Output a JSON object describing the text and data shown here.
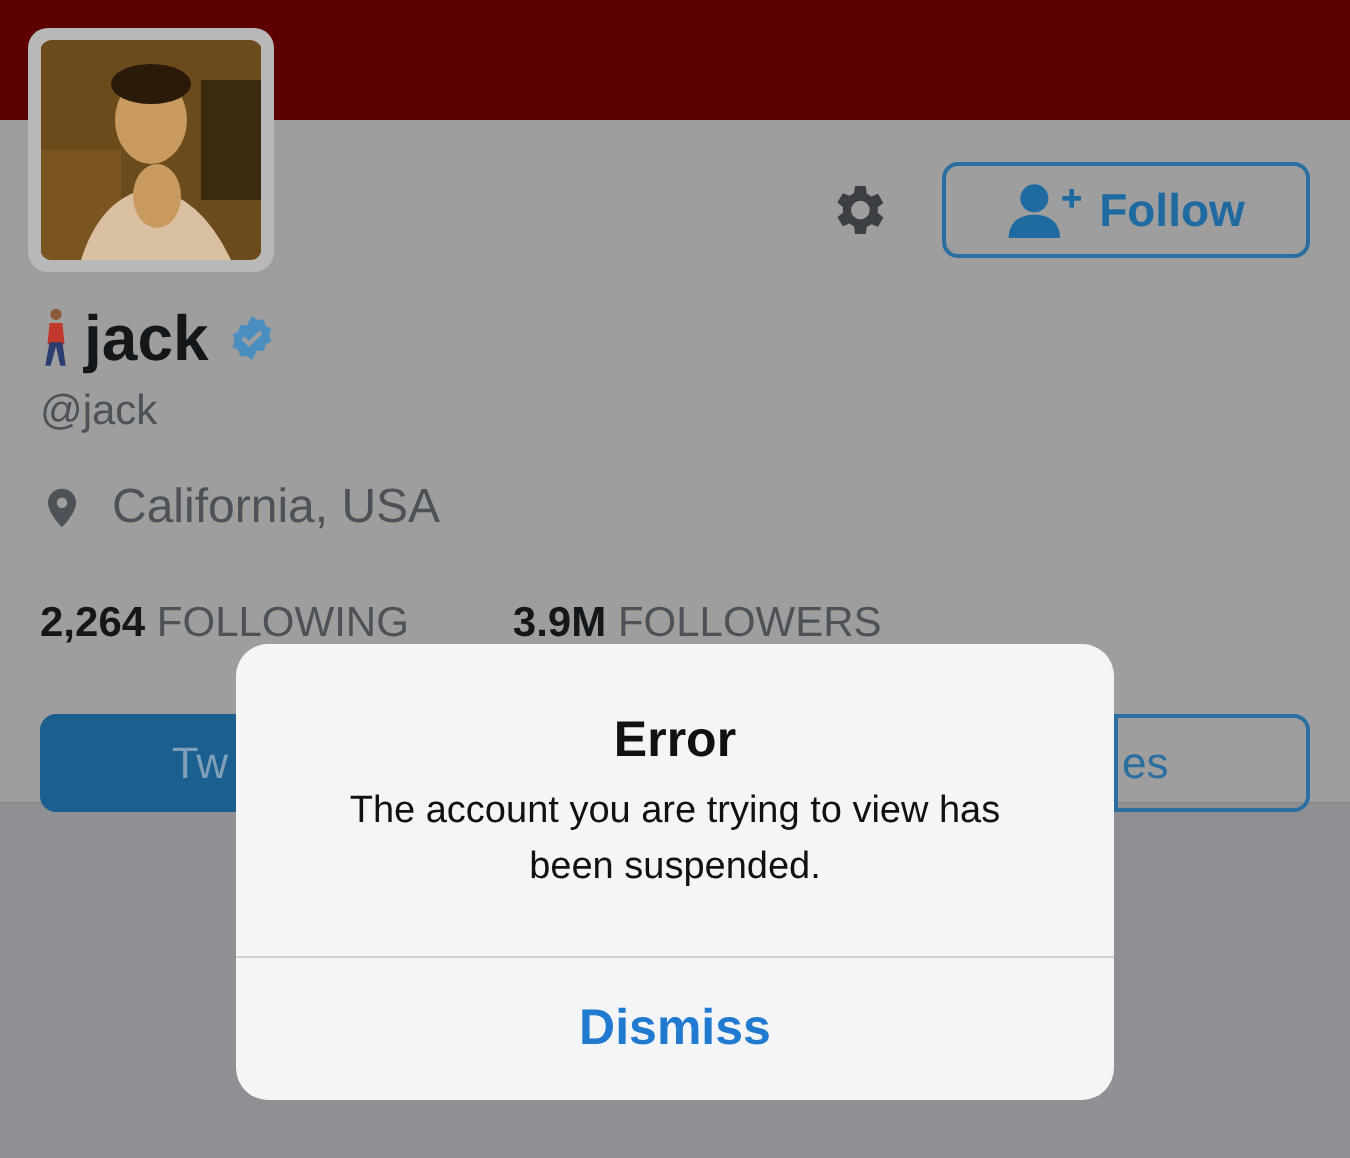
{
  "profile": {
    "name": "jack",
    "verified": true,
    "handle": "@jack",
    "location": "California, USA",
    "follow_button": "Follow",
    "stats": [
      {
        "count": "2,264",
        "label": "FOLLOWING"
      },
      {
        "count": "3.9M",
        "label": "FOLLOWERS"
      }
    ],
    "tabs": [
      {
        "label": "Tw",
        "selected": true
      },
      {
        "label": "es",
        "selected": false
      }
    ]
  },
  "alert": {
    "title": "Error",
    "message": "The account you are trying to view has been suspended.",
    "button": "Dismiss"
  }
}
